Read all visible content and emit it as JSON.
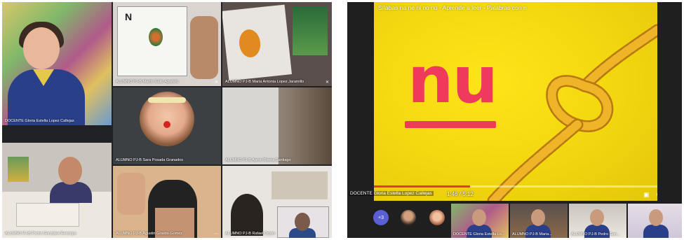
{
  "call_grid": {
    "tiles": [
      {
        "name": "DOCENTE Gloria Estella Lopez Callejas"
      },
      {
        "name": "ALUMNO PJ-B Martin Gallo Agudelo"
      },
      {
        "name": "ALUMNO PJ-B Maria Antonia Lopez Jaramillo"
      },
      {
        "name": "ALUMNO PJ-B Sara Posada Granados"
      },
      {
        "name": "ALUMNO PJ-B Aaron Rivera Santiago"
      },
      {
        "name": "ALUMNO PJ-B Pedro Gonzalez Restrepo"
      },
      {
        "name": "ALUMNO PJ-B Agustin Giraldo Gomez"
      },
      {
        "name": "ALUMNO PJ-B Rafael Orpen"
      }
    ],
    "martin_paper_letter": "N"
  },
  "presentation": {
    "video_title": "Sílabas na ne ni no nu - Aprende a leer - Palabras con n",
    "syllable": "nu",
    "time": "1:46 / 5:12",
    "progress": 0.34,
    "presenter": "DOCENTE Gloria Estella Lopez Callejas",
    "accent_color": "#ef3a5c",
    "progress_color": "#e53935",
    "icons": [
      "captions-icon",
      "settings-icon",
      "fullscreen-icon"
    ]
  },
  "participants_strip": {
    "more_count": "+3",
    "thumbs": [
      {
        "label": "DOCENTE Gloria Estella Lo..."
      },
      {
        "label": "ALUMNO PJ-B Maria..."
      },
      {
        "label": "ALUMNO PJ-B Pedro Gon..."
      },
      {
        "label": ""
      }
    ]
  }
}
